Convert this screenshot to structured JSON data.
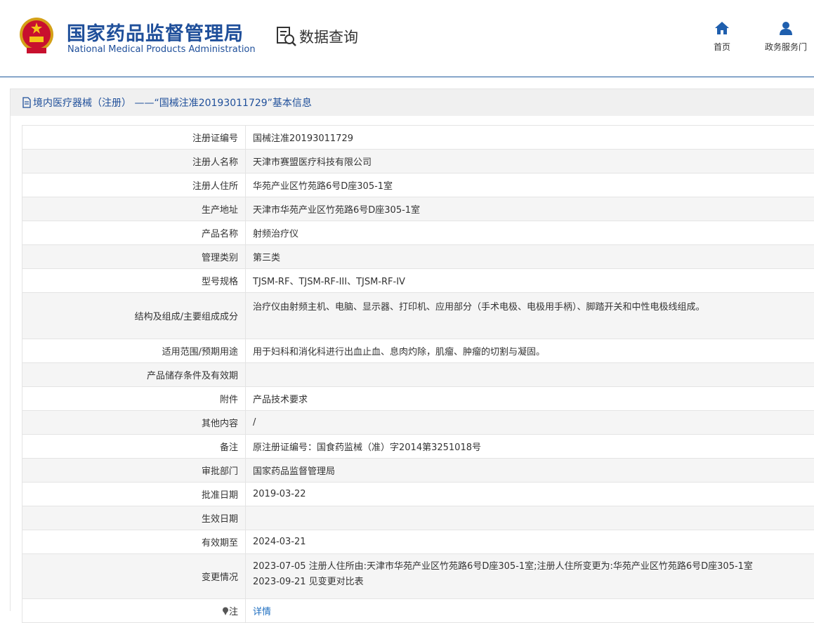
{
  "header": {
    "logo_cn": "国家药品监督管理局",
    "logo_en": "National Medical Products Administration",
    "query_label": "数据查询",
    "nav": [
      {
        "label": "首页",
        "icon": "home-icon"
      },
      {
        "label": "政务服务门",
        "icon": "user-icon"
      }
    ]
  },
  "colors": {
    "brand": "#1f4f9a",
    "accent": "#1e5a9c",
    "link": "#1f6fc0"
  },
  "title": "境内医疗器械（注册） ——“国械注准20193011729”基本信息",
  "rows": [
    {
      "label": "注册证编号",
      "value": "国械注准20193011729"
    },
    {
      "label": "注册人名称",
      "value": "天津市赛盟医疗科技有限公司"
    },
    {
      "label": "注册人住所",
      "value": "华苑产业区竹苑路6号D座305-1室"
    },
    {
      "label": "生产地址",
      "value": "天津市华苑产业区竹苑路6号D座305-1室"
    },
    {
      "label": "产品名称",
      "value": "射频治疗仪"
    },
    {
      "label": "管理类别",
      "value": "第三类"
    },
    {
      "label": "型号规格",
      "value": "TJSM-RF、TJSM-RF-III、TJSM-RF-IV"
    },
    {
      "label": "结构及组成/主要组成成分",
      "value": "治疗仪由射频主机、电脑、显示器、打印机、应用部分（手术电极、电极用手柄）、脚踏开关和中性电极线组成。"
    },
    {
      "label": "适用范围/预期用途",
      "value": "用于妇科和消化科进行出血止血、息肉灼除，肌瘤、肿瘤的切割与凝固。"
    },
    {
      "label": "产品储存条件及有效期",
      "value": ""
    },
    {
      "label": "附件",
      "value": "产品技术要求"
    },
    {
      "label": "其他内容",
      "value": "/"
    },
    {
      "label": "备注",
      "value": "原注册证编号：国食药监械（准）字2014第3251018号"
    },
    {
      "label": "审批部门",
      "value": "国家药品监督管理局"
    },
    {
      "label": "批准日期",
      "value": "2019-03-22"
    },
    {
      "label": "生效日期",
      "value": ""
    },
    {
      "label": "有效期至",
      "value": "2024-03-21"
    },
    {
      "label": "变更情况",
      "value_lines": [
        "2023-07-05 注册人住所由:天津市华苑产业区竹苑路6号D座305-1室;注册人住所变更为:华苑产业区竹苑路6号D座305-1室",
        "2023-09-21 见变更对比表"
      ]
    },
    {
      "label": "注",
      "icon": "pin-icon",
      "link": "详情"
    }
  ]
}
